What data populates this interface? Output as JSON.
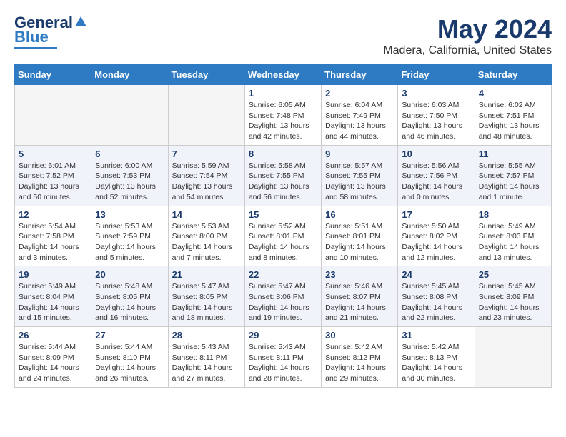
{
  "logo": {
    "line1": "General",
    "line2": "Blue"
  },
  "title": "May 2024",
  "subtitle": "Madera, California, United States",
  "weekdays": [
    "Sunday",
    "Monday",
    "Tuesday",
    "Wednesday",
    "Thursday",
    "Friday",
    "Saturday"
  ],
  "weeks": [
    [
      {
        "day": "",
        "info": ""
      },
      {
        "day": "",
        "info": ""
      },
      {
        "day": "",
        "info": ""
      },
      {
        "day": "1",
        "info": "Sunrise: 6:05 AM\nSunset: 7:48 PM\nDaylight: 13 hours\nand 42 minutes."
      },
      {
        "day": "2",
        "info": "Sunrise: 6:04 AM\nSunset: 7:49 PM\nDaylight: 13 hours\nand 44 minutes."
      },
      {
        "day": "3",
        "info": "Sunrise: 6:03 AM\nSunset: 7:50 PM\nDaylight: 13 hours\nand 46 minutes."
      },
      {
        "day": "4",
        "info": "Sunrise: 6:02 AM\nSunset: 7:51 PM\nDaylight: 13 hours\nand 48 minutes."
      }
    ],
    [
      {
        "day": "5",
        "info": "Sunrise: 6:01 AM\nSunset: 7:52 PM\nDaylight: 13 hours\nand 50 minutes."
      },
      {
        "day": "6",
        "info": "Sunrise: 6:00 AM\nSunset: 7:53 PM\nDaylight: 13 hours\nand 52 minutes."
      },
      {
        "day": "7",
        "info": "Sunrise: 5:59 AM\nSunset: 7:54 PM\nDaylight: 13 hours\nand 54 minutes."
      },
      {
        "day": "8",
        "info": "Sunrise: 5:58 AM\nSunset: 7:55 PM\nDaylight: 13 hours\nand 56 minutes."
      },
      {
        "day": "9",
        "info": "Sunrise: 5:57 AM\nSunset: 7:55 PM\nDaylight: 13 hours\nand 58 minutes."
      },
      {
        "day": "10",
        "info": "Sunrise: 5:56 AM\nSunset: 7:56 PM\nDaylight: 14 hours\nand 0 minutes."
      },
      {
        "day": "11",
        "info": "Sunrise: 5:55 AM\nSunset: 7:57 PM\nDaylight: 14 hours\nand 1 minute."
      }
    ],
    [
      {
        "day": "12",
        "info": "Sunrise: 5:54 AM\nSunset: 7:58 PM\nDaylight: 14 hours\nand 3 minutes."
      },
      {
        "day": "13",
        "info": "Sunrise: 5:53 AM\nSunset: 7:59 PM\nDaylight: 14 hours\nand 5 minutes."
      },
      {
        "day": "14",
        "info": "Sunrise: 5:53 AM\nSunset: 8:00 PM\nDaylight: 14 hours\nand 7 minutes."
      },
      {
        "day": "15",
        "info": "Sunrise: 5:52 AM\nSunset: 8:01 PM\nDaylight: 14 hours\nand 8 minutes."
      },
      {
        "day": "16",
        "info": "Sunrise: 5:51 AM\nSunset: 8:01 PM\nDaylight: 14 hours\nand 10 minutes."
      },
      {
        "day": "17",
        "info": "Sunrise: 5:50 AM\nSunset: 8:02 PM\nDaylight: 14 hours\nand 12 minutes."
      },
      {
        "day": "18",
        "info": "Sunrise: 5:49 AM\nSunset: 8:03 PM\nDaylight: 14 hours\nand 13 minutes."
      }
    ],
    [
      {
        "day": "19",
        "info": "Sunrise: 5:49 AM\nSunset: 8:04 PM\nDaylight: 14 hours\nand 15 minutes."
      },
      {
        "day": "20",
        "info": "Sunrise: 5:48 AM\nSunset: 8:05 PM\nDaylight: 14 hours\nand 16 minutes."
      },
      {
        "day": "21",
        "info": "Sunrise: 5:47 AM\nSunset: 8:05 PM\nDaylight: 14 hours\nand 18 minutes."
      },
      {
        "day": "22",
        "info": "Sunrise: 5:47 AM\nSunset: 8:06 PM\nDaylight: 14 hours\nand 19 minutes."
      },
      {
        "day": "23",
        "info": "Sunrise: 5:46 AM\nSunset: 8:07 PM\nDaylight: 14 hours\nand 21 minutes."
      },
      {
        "day": "24",
        "info": "Sunrise: 5:45 AM\nSunset: 8:08 PM\nDaylight: 14 hours\nand 22 minutes."
      },
      {
        "day": "25",
        "info": "Sunrise: 5:45 AM\nSunset: 8:09 PM\nDaylight: 14 hours\nand 23 minutes."
      }
    ],
    [
      {
        "day": "26",
        "info": "Sunrise: 5:44 AM\nSunset: 8:09 PM\nDaylight: 14 hours\nand 24 minutes."
      },
      {
        "day": "27",
        "info": "Sunrise: 5:44 AM\nSunset: 8:10 PM\nDaylight: 14 hours\nand 26 minutes."
      },
      {
        "day": "28",
        "info": "Sunrise: 5:43 AM\nSunset: 8:11 PM\nDaylight: 14 hours\nand 27 minutes."
      },
      {
        "day": "29",
        "info": "Sunrise: 5:43 AM\nSunset: 8:11 PM\nDaylight: 14 hours\nand 28 minutes."
      },
      {
        "day": "30",
        "info": "Sunrise: 5:42 AM\nSunset: 8:12 PM\nDaylight: 14 hours\nand 29 minutes."
      },
      {
        "day": "31",
        "info": "Sunrise: 5:42 AM\nSunset: 8:13 PM\nDaylight: 14 hours\nand 30 minutes."
      },
      {
        "day": "",
        "info": ""
      }
    ]
  ]
}
